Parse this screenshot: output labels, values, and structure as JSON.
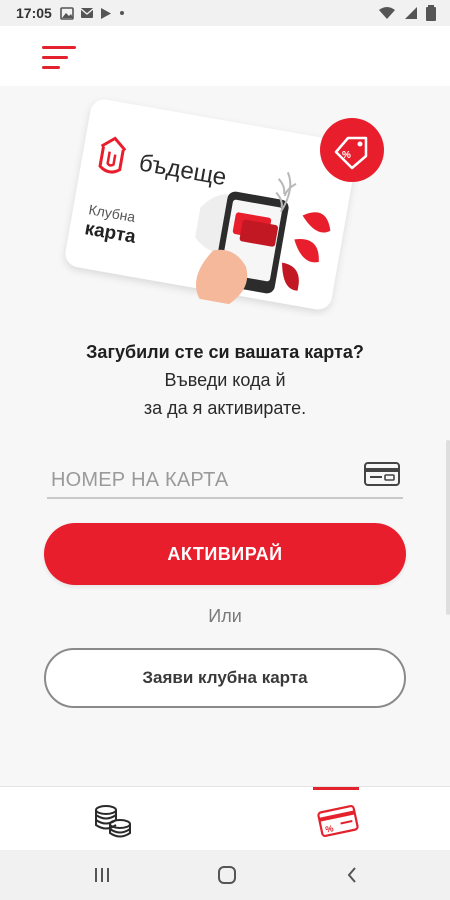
{
  "status_bar": {
    "time": "17:05"
  },
  "hero": {
    "brand_name": "бъдеще",
    "card_label_top": "Клубна",
    "card_label_bottom": "карта"
  },
  "prompt": {
    "title": "Загубили сте си вашата карта?",
    "line1": "Въведи кода й",
    "line2": "за да я активирате."
  },
  "card_input": {
    "placeholder": "НОМЕР НА КАРТА",
    "value": ""
  },
  "buttons": {
    "activate": "АКТИВИРАЙ",
    "or": "Или",
    "request_card": "Заяви клубна карта"
  },
  "colors": {
    "accent": "#e91e2d",
    "text": "#222222",
    "muted": "#9a9a9a"
  },
  "bottom_nav": {
    "tabs": [
      {
        "icon": "coins-icon",
        "active": false
      },
      {
        "icon": "discount-card-icon",
        "active": true
      }
    ]
  },
  "system_nav": {
    "icons": [
      "recent-apps-icon",
      "home-icon",
      "back-icon"
    ]
  }
}
